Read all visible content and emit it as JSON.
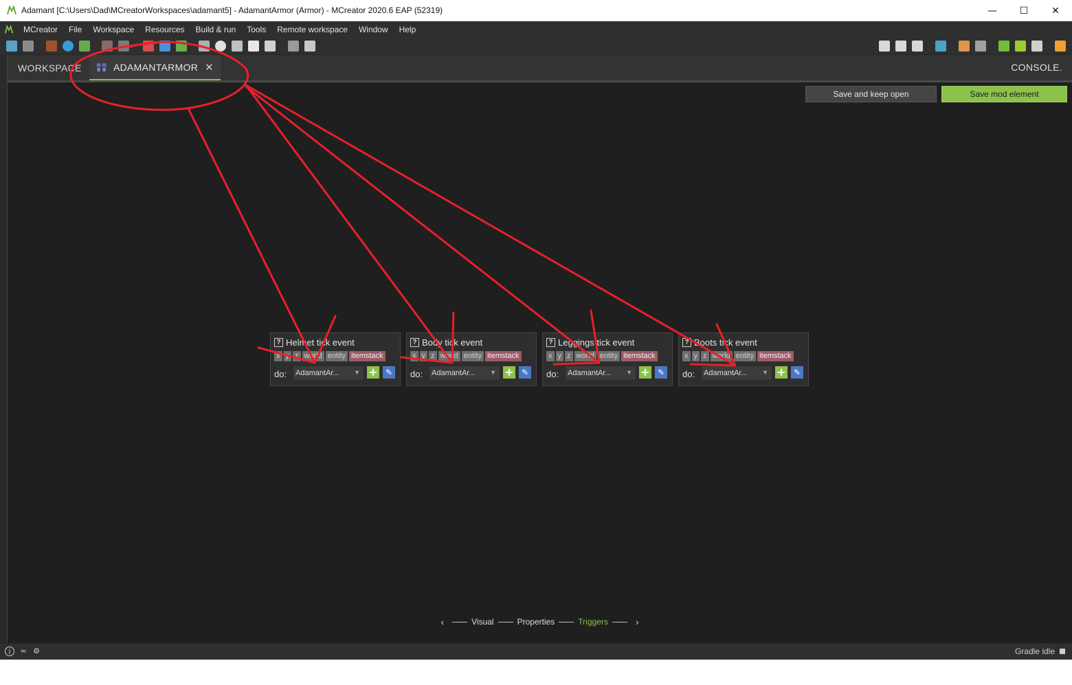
{
  "window": {
    "title": "Adamant [C:\\Users\\Dad\\MCreatorWorkspaces\\adamant5] - AdamantArmor (Armor) - MCreator 2020.6 EAP (52319)",
    "minimize": "—",
    "maximize": "☐",
    "close": "✕"
  },
  "menu": [
    "MCreator",
    "File",
    "Workspace",
    "Resources",
    "Build & run",
    "Tools",
    "Remote workspace",
    "Window",
    "Help"
  ],
  "tabs": {
    "workspace": "WORKSPACE",
    "element": "ADAMANTARMOR",
    "close": "✕",
    "console": "CONSOLE."
  },
  "actions": {
    "keep_open": "Save and keep open",
    "save": "Save mod element"
  },
  "triggers": [
    {
      "title": "Helmet tick event",
      "deps": [
        "x",
        "y",
        "z",
        "world",
        "entity",
        "itemstack"
      ],
      "do": "do:",
      "procedure": "AdamantAr..."
    },
    {
      "title": "Body tick event",
      "deps": [
        "x",
        "y",
        "z",
        "world",
        "entity",
        "itemstack"
      ],
      "do": "do:",
      "procedure": "AdamantAr..."
    },
    {
      "title": "Leggings tick event",
      "deps": [
        "x",
        "y",
        "z",
        "world",
        "entity",
        "itemstack"
      ],
      "do": "do:",
      "procedure": "AdamantAr..."
    },
    {
      "title": "Boots tick event",
      "deps": [
        "x",
        "y",
        "z",
        "world",
        "entity",
        "itemstack"
      ],
      "do": "do:",
      "procedure": "AdamantAr..."
    }
  ],
  "pager": {
    "prev": "‹",
    "visual": "Visual",
    "properties": "Properties",
    "triggers": "Triggers",
    "next": "›"
  },
  "status": {
    "gradle": "Gradle idle"
  },
  "colors": {
    "accent": "#8bc34a",
    "annotation": "#e8202a",
    "itemstack": "#9c5a67"
  }
}
